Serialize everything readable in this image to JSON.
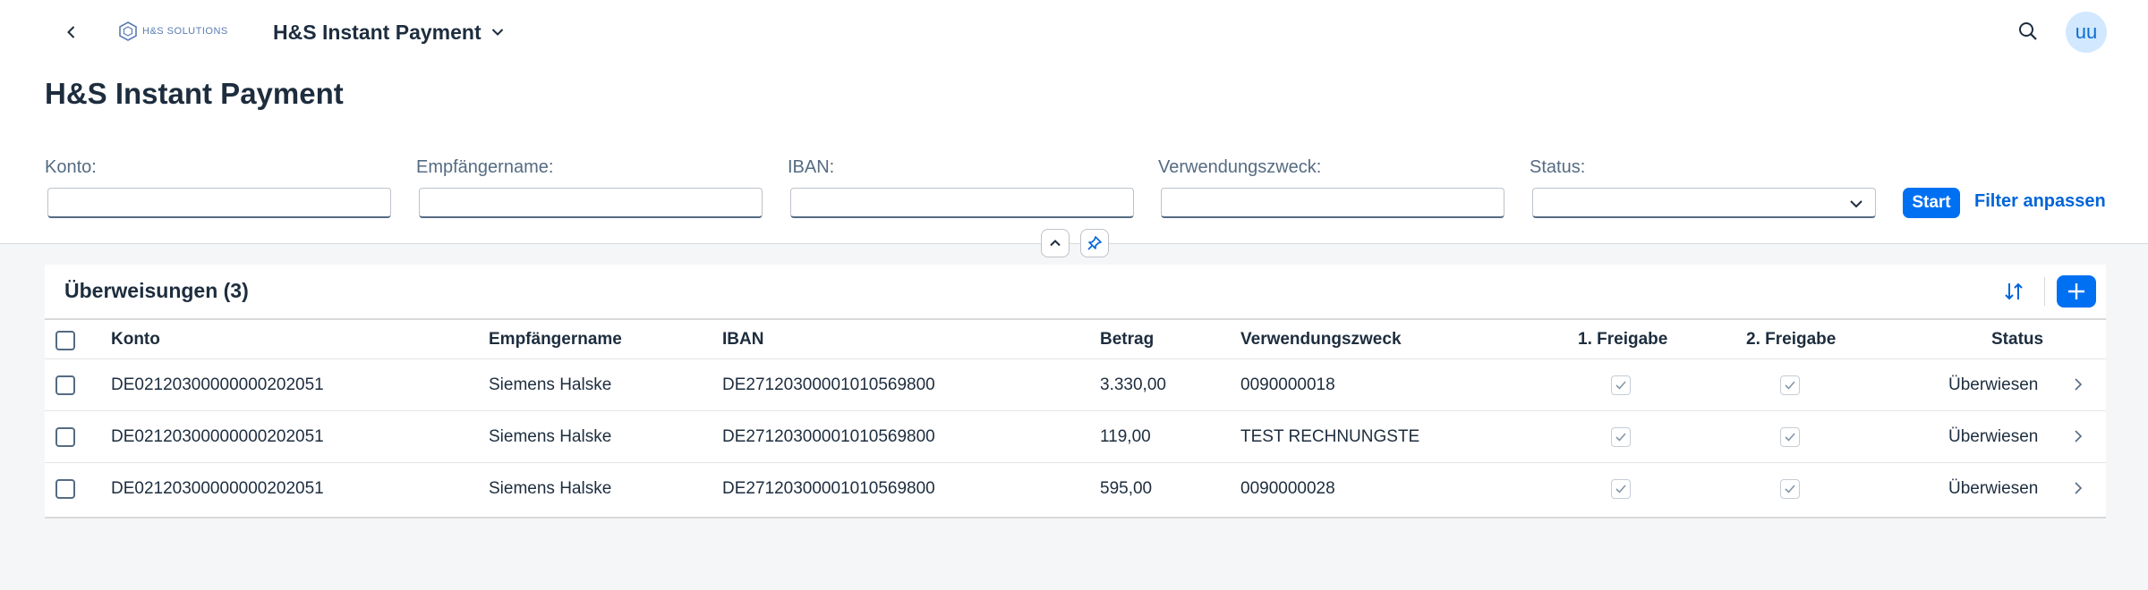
{
  "shell": {
    "app_title": "H&S Instant Payment",
    "logo_text": "H&S SOLUTIONS",
    "avatar_initials": "uu"
  },
  "page": {
    "title": "H&S Instant Payment"
  },
  "filters": {
    "konto_label": "Konto:",
    "empfaenger_label": "Empfängername:",
    "iban_label": "IBAN:",
    "zweck_label": "Verwendungszweck:",
    "status_label": "Status:",
    "start_label": "Start",
    "adapt_label": "Filter anpassen"
  },
  "table": {
    "title": "Überweisungen (3)",
    "columns": {
      "konto": "Konto",
      "empfaenger": "Empfängername",
      "iban": "IBAN",
      "betrag": "Betrag",
      "zweck": "Verwendungszweck",
      "freigabe1": "1. Freigabe",
      "freigabe2": "2. Freigabe",
      "status": "Status"
    },
    "rows": [
      {
        "konto": "DE02120300000000202051",
        "empfaenger": "Siemens Halske",
        "iban": "DE27120300001010569800",
        "betrag": "3.330,00",
        "zweck": "0090000018",
        "status": "Überwiesen"
      },
      {
        "konto": "DE02120300000000202051",
        "empfaenger": "Siemens Halske",
        "iban": "DE27120300001010569800",
        "betrag": "119,00",
        "zweck": "TEST RECHNUNGSTE",
        "status": "Überwiesen"
      },
      {
        "konto": "DE02120300000000202051",
        "empfaenger": "Siemens Halske",
        "iban": "DE27120300001010569800",
        "betrag": "595,00",
        "zweck": "0090000028",
        "status": "Überwiesen"
      }
    ]
  },
  "colors": {
    "accent": "#0070f2",
    "link": "#0064d9",
    "text": "#1d2d3e"
  }
}
